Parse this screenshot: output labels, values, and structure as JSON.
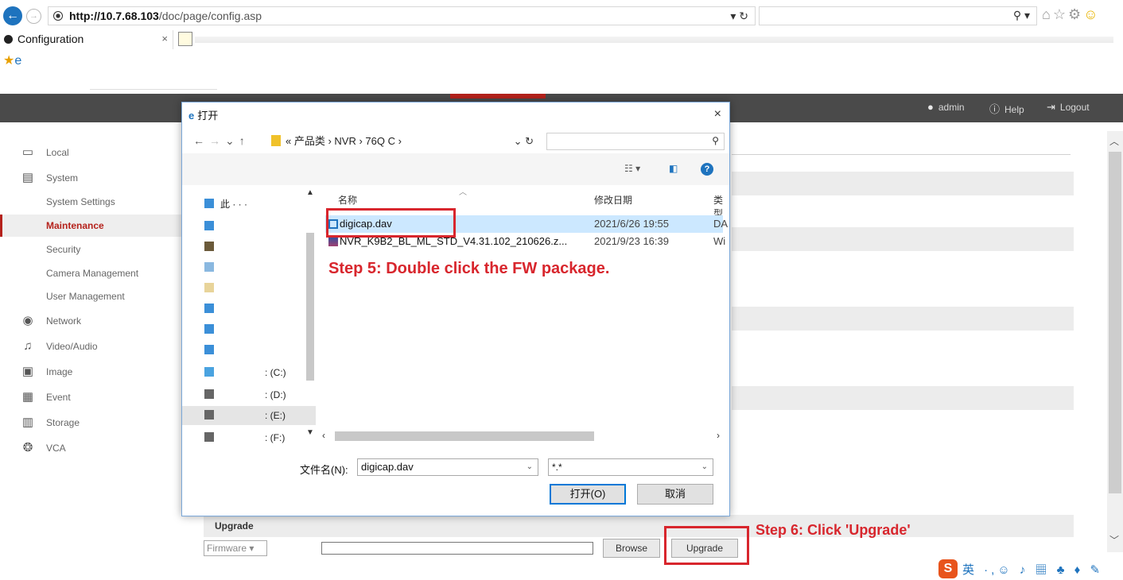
{
  "browser": {
    "url_host": "http://10.7.68.103",
    "url_path": "/doc/page/config.asp",
    "tab_title": "Configuration"
  },
  "header": {
    "user": "admin",
    "help": "Help",
    "logout": "Logout"
  },
  "sidebar": {
    "items": [
      {
        "label": "Local"
      },
      {
        "label": "System"
      },
      {
        "label": "System Settings"
      },
      {
        "label": "Maintenance"
      },
      {
        "label": "Security"
      },
      {
        "label": "Camera Management"
      },
      {
        "label": "User Management"
      },
      {
        "label": "Network"
      },
      {
        "label": "Video/Audio"
      },
      {
        "label": "Image"
      },
      {
        "label": "Event"
      },
      {
        "label": "Storage"
      },
      {
        "label": "VCA"
      }
    ]
  },
  "dialog": {
    "title": "打开",
    "close": "×",
    "breadcrumb": "« 产品类 › NVR › 76Q C ›",
    "columns": {
      "name": "名称",
      "date": "修改日期",
      "type": "类型"
    },
    "tree": [
      {
        "label": "此 · · ·"
      },
      {
        "label": ""
      },
      {
        "label": ""
      },
      {
        "label": ""
      },
      {
        "label": ""
      },
      {
        "label": ""
      },
      {
        "label": ""
      },
      {
        "label": ""
      },
      {
        "label": ": (C:)"
      },
      {
        "label": ": (D:)"
      },
      {
        "label": ": (E:)"
      },
      {
        "label": ": (F:)"
      }
    ],
    "files": [
      {
        "name": "digicap.dav",
        "date": "2021/6/26 19:55",
        "type": "DA"
      },
      {
        "name": "NVR_K9B2_BL_ML_STD_V4.31.102_210626.z...",
        "date": "2021/9/23 16:39",
        "type": "Wi"
      }
    ],
    "filename_label": "文件名(N):",
    "filename_value": "digicap.dav",
    "filter_value": "*.*",
    "open_button": "打开(O)",
    "cancel_button": "取消"
  },
  "annotations": {
    "step5": "Step 5: Double click the FW package.",
    "step6": "Step 6: Click 'Upgrade'"
  },
  "upgrade": {
    "section_label": "Upgrade",
    "firmware_select": "Firmware",
    "browse_button": "Browse",
    "upgrade_button": "Upgrade"
  },
  "colors": {
    "accent_red": "#d8262d",
    "brand_red": "#b5221c",
    "header_bg": "#4a4a4a",
    "selection_blue": "#cce8ff"
  }
}
